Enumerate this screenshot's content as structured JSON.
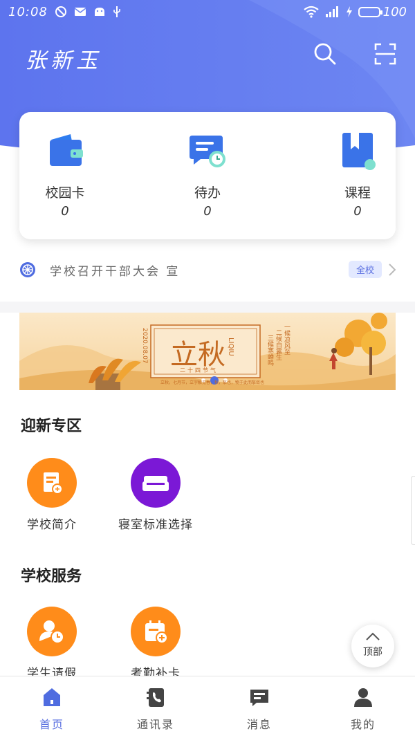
{
  "status_bar": {
    "time": "10:08",
    "battery": "100"
  },
  "header": {
    "title": "张新玉"
  },
  "quick_card": {
    "items": [
      {
        "label": "校园卡",
        "count": "0",
        "icon": "wallet-icon"
      },
      {
        "label": "待办",
        "count": "0",
        "icon": "todo-chat-icon"
      },
      {
        "label": "课程",
        "count": "0",
        "icon": "course-book-icon"
      }
    ]
  },
  "notice": {
    "text": "学校召开干部大会 宣",
    "badge": "全校"
  },
  "banner": {
    "title": "立秋",
    "pinyin": "LIQIU",
    "date": "2020.08.07",
    "subtitle": "二十四节气",
    "poem_1": "一候凉风至",
    "poem_2": "二候白露生",
    "poem_3": "三候寒蝉鸣",
    "caption": "立秋，七月节，立字解见春，秋，揫也，物于此而揫敛也"
  },
  "sections": [
    {
      "title": "迎新专区",
      "items": [
        {
          "label": "学校简介",
          "icon": "school-intro-icon",
          "color": "#ff8c1a"
        },
        {
          "label": "寝室标准选择",
          "icon": "dorm-bed-icon",
          "color": "#7b18d6"
        }
      ]
    },
    {
      "title": "学校服务",
      "items": [
        {
          "label": "学生请假",
          "icon": "student-leave-icon",
          "color": "#ff8c1a"
        },
        {
          "label": "考勤补卡",
          "icon": "attendance-calendar-icon",
          "color": "#ff8c1a"
        }
      ]
    }
  ],
  "float_button": {
    "label": "顶部"
  },
  "tabbar": {
    "tabs": [
      {
        "label": "首页",
        "icon": "home-icon",
        "active": true
      },
      {
        "label": "通讯录",
        "icon": "contacts-icon",
        "active": false
      },
      {
        "label": "消息",
        "icon": "message-icon",
        "active": false
      },
      {
        "label": "我的",
        "icon": "profile-icon",
        "active": false
      }
    ]
  },
  "colors": {
    "primary": "#5a6fe0",
    "orange": "#ff8c1a",
    "purple": "#7b18d6"
  }
}
